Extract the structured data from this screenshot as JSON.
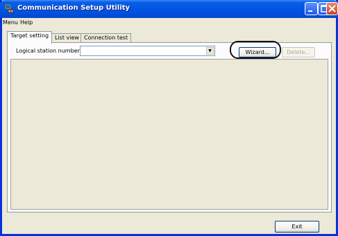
{
  "window": {
    "title": "Communication Setup Utility"
  },
  "menubar": {
    "items": [
      "Menu",
      "Help"
    ]
  },
  "tabs": [
    {
      "label": "Target setting",
      "active": true
    },
    {
      "label": "List view",
      "active": false
    },
    {
      "label": "Connection test",
      "active": false
    }
  ],
  "target_setting": {
    "logical_station_label": "Logical station number",
    "logical_station_value": "",
    "wizard_label": "Wizard...",
    "delete_label": "Delete...",
    "delete_enabled": false
  },
  "footer": {
    "exit_label": "Exit"
  },
  "colors": {
    "titlebar": "#0254e2",
    "window_border": "#0831d9",
    "face": "#ece9d8",
    "highlight_circle": "#111111"
  },
  "icons": {
    "app": "computer-network-icon",
    "minimize": "minimize-icon",
    "maximize": "maximize-icon",
    "close": "close-icon",
    "dropdown": "chevron-down-icon"
  }
}
